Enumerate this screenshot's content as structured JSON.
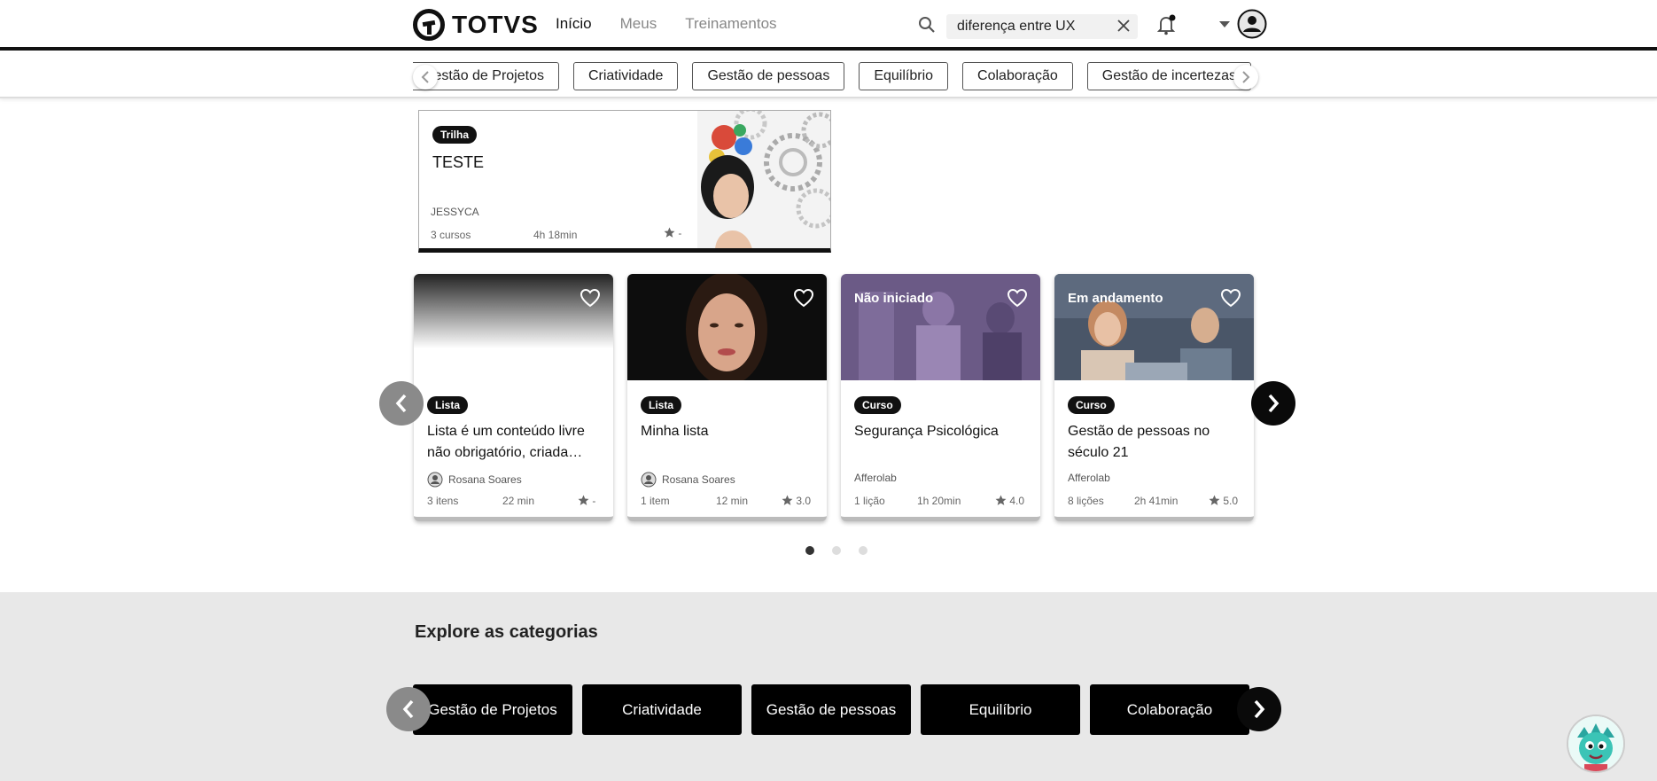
{
  "header": {
    "brand": "TOTVS",
    "nav": [
      "Início",
      "Meus",
      "Treinamentos"
    ],
    "search_value": "diferença entre UX"
  },
  "tags": [
    "Gestão de Projetos",
    "Criatividade",
    "Gestão de pessoas",
    "Equilíbrio",
    "Colaboração",
    "Gestão de incertezas"
  ],
  "trail": {
    "badge": "Trilha",
    "title": "TESTE",
    "author": "JESSYCA",
    "courses": "3 cursos",
    "duration": "4h 18min",
    "rating": "-"
  },
  "cards": [
    {
      "status": "",
      "badge": "Lista",
      "title": "Lista é um conteúdo livre não obrigatório, criada…",
      "author": "Rosana Soares",
      "count": "3 itens",
      "duration": "22 min",
      "rating": "-"
    },
    {
      "status": "",
      "badge": "Lista",
      "title": "Minha lista",
      "author": "Rosana Soares",
      "count": "1 item",
      "duration": "12 min",
      "rating": "3.0"
    },
    {
      "status": "Não iniciado",
      "badge": "Curso",
      "title": "Segurança Psicológica",
      "author": "Afferolab",
      "count": "1 lição",
      "duration": "1h 20min",
      "rating": "4.0"
    },
    {
      "status": "Em andamento",
      "badge": "Curso",
      "title": "Gestão de pessoas no século 21",
      "author": "Afferolab",
      "count": "8 lições",
      "duration": "2h 41min",
      "rating": "5.0"
    }
  ],
  "categories": {
    "title": "Explore as categorias",
    "items": [
      "Gestão de Projetos",
      "Criatividade",
      "Gestão de pessoas",
      "Equilíbrio",
      "Colaboração"
    ]
  },
  "pagination": {
    "total": 3,
    "active": 1
  }
}
